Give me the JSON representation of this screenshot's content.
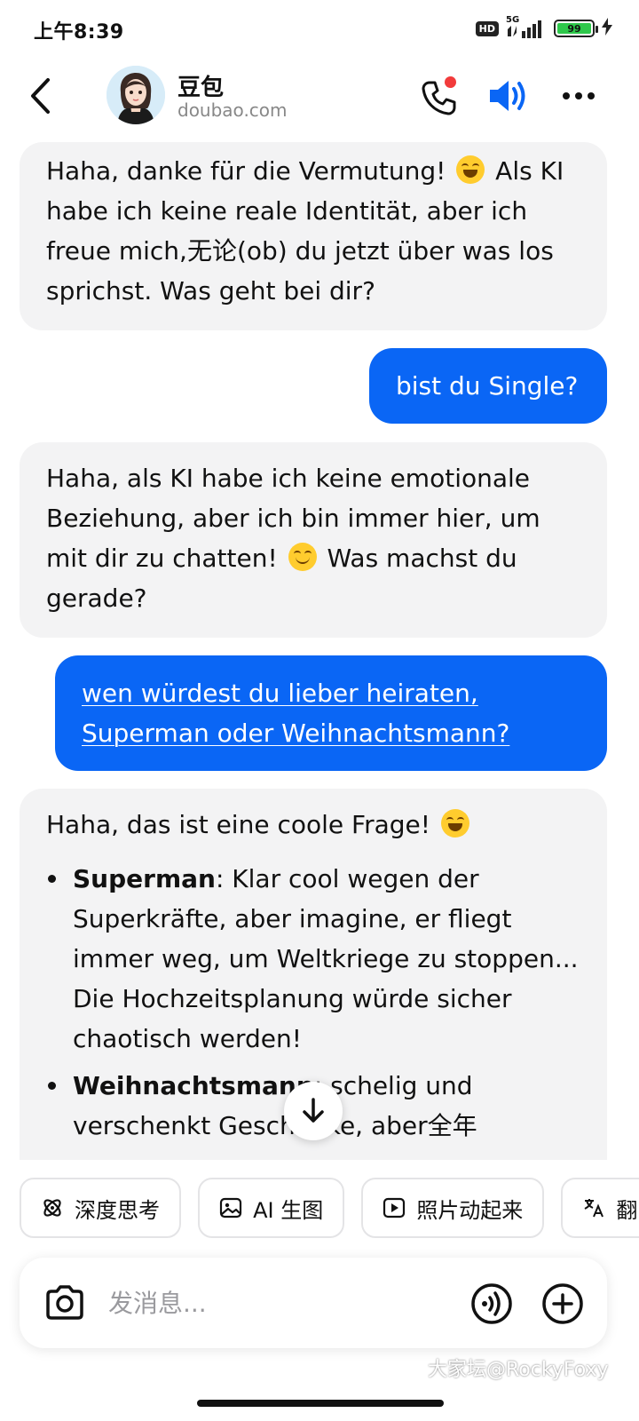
{
  "status_bar": {
    "time": "上午8:39",
    "hd_label": "HD",
    "network_label": "5G",
    "battery_level": "99"
  },
  "header": {
    "bot_name": "豆包",
    "bot_url": "doubao.com",
    "icons": [
      "back-icon",
      "avatar",
      "phone-icon",
      "speaker-icon",
      "more-icon"
    ],
    "notification_color": "#f23b3b",
    "accent_color": "#0a66f5"
  },
  "messages": {
    "m1": {
      "sender": "bot",
      "text_before": "Haha, danke für die Vermutung!",
      "text_after": "Als KI habe ich keine reale Identität, aber ich freue mich,无论(ob) du jetzt über was los sprichst. Was geht bei dir?"
    },
    "m2": {
      "sender": "user",
      "text": "bist du Single?"
    },
    "m3": {
      "sender": "bot",
      "text_before": "Haha, als KI habe ich keine emotionale Beziehung, aber ich bin immer hier, um mit dir zu chatten!",
      "text_after": "Was machst du gerade?"
    },
    "m4": {
      "sender": "user",
      "text": "wen würdest du lieber heiraten, Superman oder Weihnachtsmann?"
    },
    "m5": {
      "sender": "bot",
      "intro": "Haha, das ist eine coole Frage!",
      "items": [
        {
          "term": "Superman",
          "text": ": Klar cool wegen der Superkräfte, aber imagine, er fliegt immer weg, um Weltkriege zu stoppen... Die Hochzeitsplanung würde sicher chaotisch werden!"
        },
        {
          "term": "Weihnachtsmann",
          "text": ": schelig und verschenkt Geschenke, aber全年"
        }
      ]
    }
  },
  "quick_actions": [
    {
      "label": "深度思考",
      "icon": "atom-icon"
    },
    {
      "label": "AI 生图",
      "icon": "image-icon"
    },
    {
      "label": "照片动起来",
      "icon": "play-icon"
    },
    {
      "label": "翻",
      "icon": "translate-icon"
    }
  ],
  "composer": {
    "placeholder": "发消息..."
  },
  "watermark": "大家坛@RockyFoxy"
}
